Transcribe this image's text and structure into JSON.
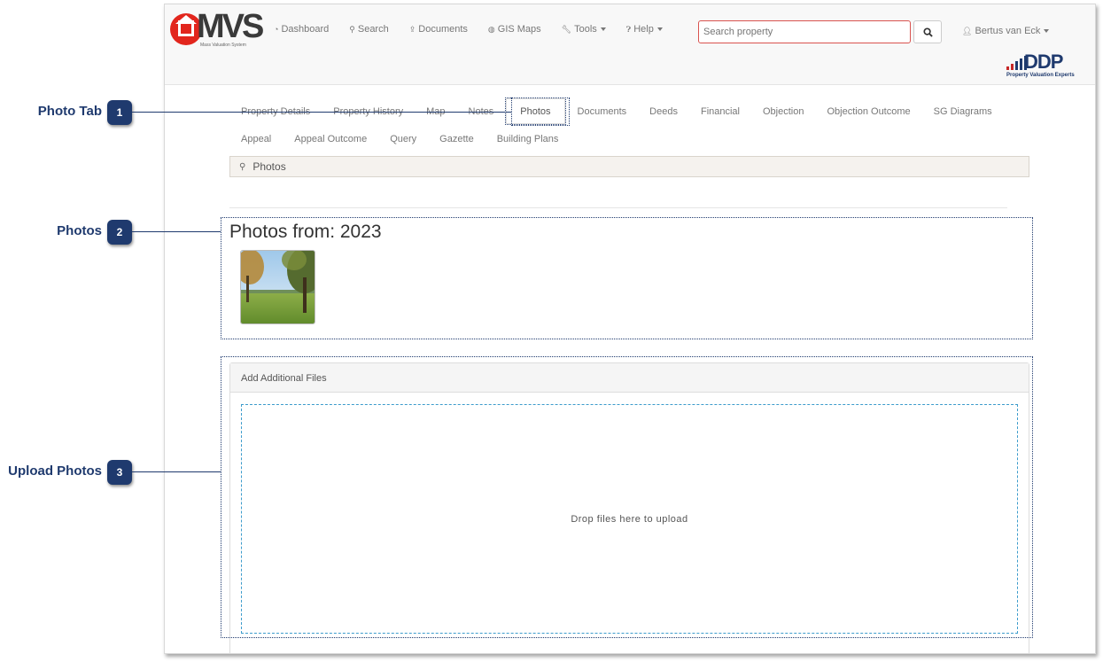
{
  "brand": {
    "logo_text": "MVS",
    "logo_subtitle": "Mass Valuation System",
    "partner_text": "DDP",
    "partner_subtitle": "Property Valuation Experts"
  },
  "nav": {
    "items": [
      {
        "label": "Dashboard",
        "icon": "dashboard-icon",
        "has_caret": false
      },
      {
        "label": "Search",
        "icon": "search-icon",
        "has_caret": false
      },
      {
        "label": "Documents",
        "icon": "upload-icon",
        "has_caret": false
      },
      {
        "label": "GIS Maps",
        "icon": "globe-icon",
        "has_caret": false
      },
      {
        "label": "Tools",
        "icon": "wrench-icon",
        "has_caret": true
      },
      {
        "label": "Help",
        "icon": "question-icon",
        "has_caret": true
      }
    ],
    "search_placeholder": "Search property",
    "user_name": "Bertus van Eck"
  },
  "tabs": {
    "row1": [
      "Property Details",
      "Property History",
      "Map",
      "Notes",
      "Photos",
      "Documents",
      "Deeds",
      "Financial",
      "Objection",
      "Objection Outcome",
      "SG Diagrams"
    ],
    "row2": [
      "Appeal",
      "Appeal Outcome",
      "Query",
      "Gazette",
      "Building Plans"
    ],
    "active": "Photos"
  },
  "section": {
    "title": "Photos"
  },
  "photos": {
    "heading": "Photos from: 2023"
  },
  "upload": {
    "panel_title": "Add Additional Files",
    "dropzone_text": "Drop files here to upload"
  },
  "callouts": [
    {
      "number": "1",
      "label": "Photo Tab"
    },
    {
      "number": "2",
      "label": "Photos"
    },
    {
      "number": "3",
      "label": "Upload Photos"
    }
  ],
  "colors": {
    "accent": "#1f3a6e",
    "brand_red": "#e2261d",
    "dropzone_border": "#3d9ccc"
  }
}
